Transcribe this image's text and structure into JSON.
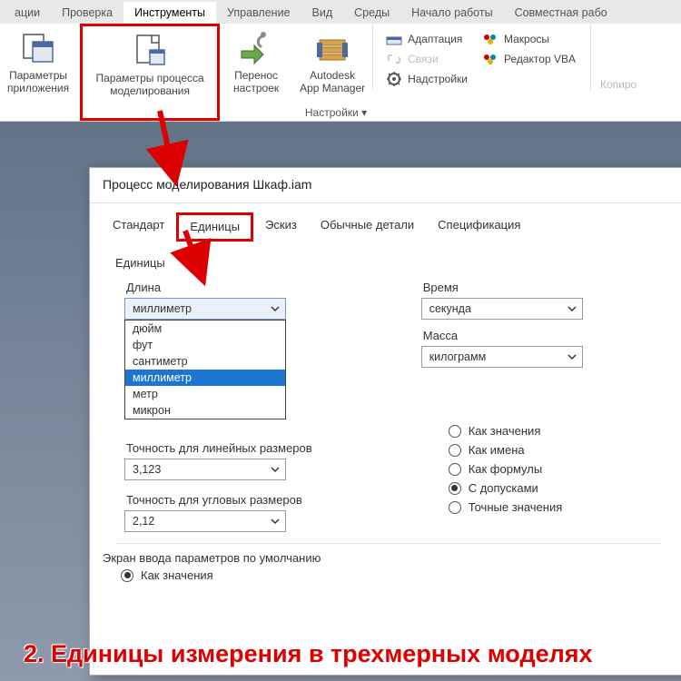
{
  "menubar": {
    "items": [
      "ации",
      "Проверка",
      "Инструменты",
      "Управление",
      "Вид",
      "Среды",
      "Начало работы",
      "Совместная рабо"
    ],
    "active_index": 2
  },
  "ribbon": {
    "btn_app_params": "Параметры\nприложения",
    "btn_proc_params": "Параметры процесса\nмоделирования",
    "btn_transfer": "Перенос\nнастроек",
    "btn_appmgr": "Autodesk\nApp Manager",
    "footer": "Настройки ▾",
    "small": {
      "adapt": "Адаптация",
      "links": "Связи",
      "addins": "Надстройки",
      "macros": "Макросы",
      "vba": "Редактор VBA"
    },
    "copy": "Копиро"
  },
  "dialog": {
    "title": "Процесс моделирования Шкаф.iam",
    "tabs": [
      "Стандарт",
      "Единицы",
      "Эскиз",
      "Обычные детали",
      "Спецификация"
    ],
    "selected_tab_index": 1,
    "group_units": "Единицы",
    "len_label": "Длина",
    "len_value": "миллиметр",
    "len_options": [
      "дюйм",
      "фут",
      "сантиметр",
      "миллиметр",
      "метр",
      "микрон"
    ],
    "len_selected_index": 3,
    "time_label": "Время",
    "time_value": "секунда",
    "mass_label": "Масса",
    "mass_value": "килограмм",
    "lin_prec_label": "Точность для линейных размеров",
    "lin_prec_value": "3,123",
    "ang_prec_label": "Точность для угловых размеров",
    "ang_prec_value": "2,12",
    "radios": [
      "Как значения",
      "Как имена",
      "Как формулы",
      "С допусками",
      "Точные значения"
    ],
    "radio_selected": 3,
    "screen_label": "Экран ввода параметров по умолчанию",
    "screen_radio": "Как значения"
  },
  "caption": "2. Единицы измерения в трехмерных моделях"
}
